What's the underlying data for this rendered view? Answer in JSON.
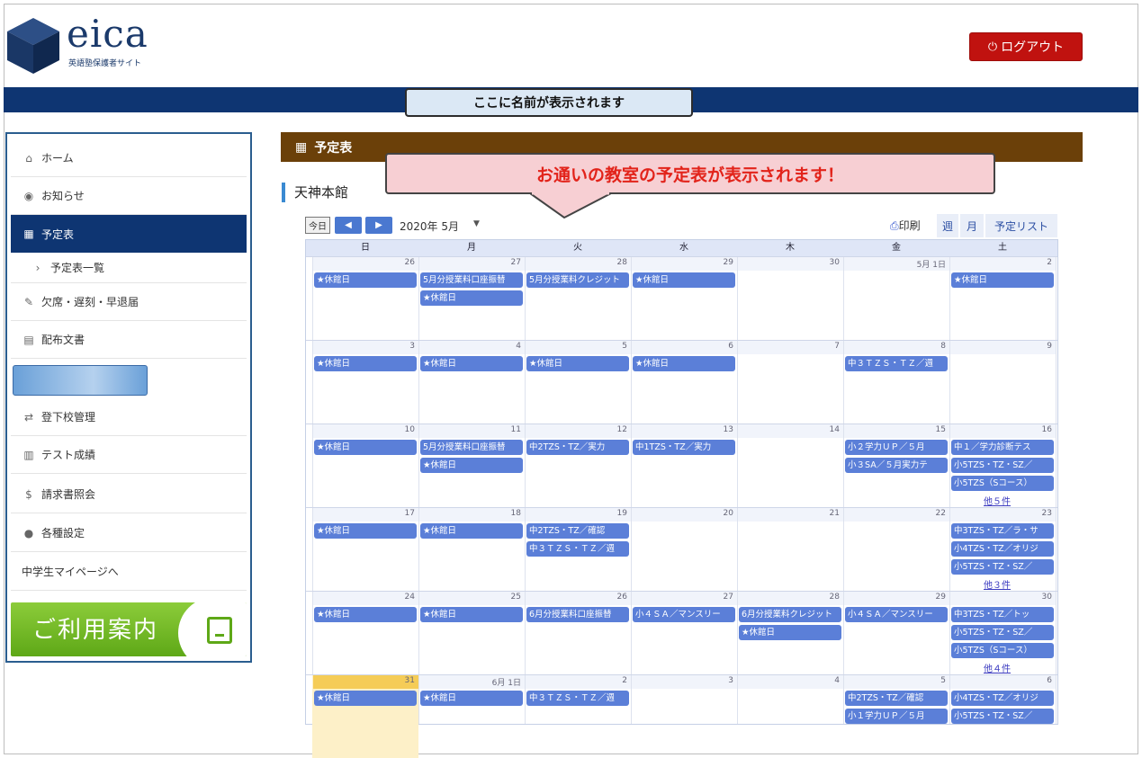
{
  "header": {
    "logo": "eica",
    "logo_sub": "英語塾保護者サイト",
    "logout_label": "ログアウト"
  },
  "name_banner": "ここに名前が表示されます",
  "sidebar": {
    "items": [
      {
        "icon": "home-icon",
        "glyph": "⌂",
        "label": "ホーム"
      },
      {
        "icon": "info-icon",
        "glyph": "◉",
        "label": "お知らせ"
      },
      {
        "icon": "calendar-icon",
        "glyph": "▦",
        "label": "予定表",
        "active": true
      },
      {
        "icon": "chevron-right-icon",
        "glyph": "›",
        "label": "予定表一覧",
        "sub": true
      },
      {
        "icon": "edit-icon",
        "glyph": "✎",
        "label": "欠席・遅刻・早退届"
      },
      {
        "icon": "document-icon",
        "glyph": "▤",
        "label": "配布文書"
      },
      {
        "icon": "transfer-icon",
        "glyph": "⇄",
        "label": "登下校管理"
      },
      {
        "icon": "bar-chart-icon",
        "glyph": "▥",
        "label": "テスト成績"
      },
      {
        "icon": "dollar-icon",
        "glyph": "$",
        "label": "請求書照会"
      },
      {
        "icon": "user-icon",
        "glyph": "●",
        "label": "各種設定"
      },
      {
        "icon": "none",
        "glyph": "",
        "label": "中学生マイページへ"
      }
    ],
    "guide_label": "ご利用案内"
  },
  "main": {
    "section_title": "予定表",
    "school_name": "天神本館",
    "callout": "お通いの教室の予定表が表示されます！"
  },
  "toolbar": {
    "today": "今日",
    "prev": "◀",
    "next": "▶",
    "month": "2020年 5月",
    "print": "印刷",
    "views": [
      "週",
      "月",
      "予定リスト"
    ]
  },
  "calendar": {
    "weekdays": [
      "日",
      "月",
      "火",
      "水",
      "木",
      "金",
      "土"
    ],
    "weeks": [
      {
        "days": [
          "26",
          "27",
          "28",
          "29",
          "30",
          "5月 1日",
          "2"
        ],
        "events": [
          [
            0,
            0,
            "★休館日"
          ],
          [
            1,
            0,
            "5月分授業料口座振替"
          ],
          [
            1,
            1,
            "★休館日"
          ],
          [
            2,
            0,
            "5月分授業料クレジット"
          ],
          [
            3,
            0,
            "★休館日"
          ],
          [
            6,
            0,
            "★休館日"
          ]
        ],
        "more": []
      },
      {
        "days": [
          "3",
          "4",
          "5",
          "6",
          "7",
          "8",
          "9"
        ],
        "events": [
          [
            0,
            0,
            "★休館日"
          ],
          [
            1,
            0,
            "★休館日"
          ],
          [
            2,
            0,
            "★休館日"
          ],
          [
            3,
            0,
            "★休館日"
          ],
          [
            5,
            0,
            "中３ＴＺＳ・ＴＺ／週"
          ]
        ],
        "more": []
      },
      {
        "days": [
          "10",
          "11",
          "12",
          "13",
          "14",
          "15",
          "16"
        ],
        "events": [
          [
            0,
            0,
            "★休館日"
          ],
          [
            1,
            0,
            "5月分授業料口座振替"
          ],
          [
            1,
            1,
            "★休館日"
          ],
          [
            2,
            0,
            "中2TZS・TZ／実力"
          ],
          [
            3,
            0,
            "中1TZS・TZ／実力"
          ],
          [
            5,
            0,
            "小２学力ＵＰ／５月"
          ],
          [
            5,
            1,
            "小３SA／５月実力テ"
          ],
          [
            6,
            0,
            "中１／学力診断テス"
          ],
          [
            6,
            1,
            "小5TZS・TZ・SZ／"
          ],
          [
            6,
            2,
            "小5TZS（Sコース）"
          ]
        ],
        "more": [
          [
            6,
            "他５件"
          ]
        ]
      },
      {
        "days": [
          "17",
          "18",
          "19",
          "20",
          "21",
          "22",
          "23"
        ],
        "events": [
          [
            0,
            0,
            "★休館日"
          ],
          [
            1,
            0,
            "★休館日"
          ],
          [
            2,
            0,
            "中2TZS・TZ／確認"
          ],
          [
            2,
            1,
            "中３ＴＺＳ・ＴＺ／週"
          ],
          [
            6,
            0,
            "中3TZS・TZ／ラ・サ"
          ],
          [
            6,
            1,
            "小4TZS・TZ／オリジ"
          ],
          [
            6,
            2,
            "小5TZS・TZ・SZ／"
          ]
        ],
        "more": [
          [
            6,
            "他３件"
          ]
        ]
      },
      {
        "days": [
          "24",
          "25",
          "26",
          "27",
          "28",
          "29",
          "30"
        ],
        "events": [
          [
            0,
            0,
            "★休館日"
          ],
          [
            1,
            0,
            "★休館日"
          ],
          [
            2,
            0,
            "6月分授業料口座振替"
          ],
          [
            3,
            0,
            "小４ＳＡ／マンスリー"
          ],
          [
            4,
            0,
            "6月分授業料クレジット"
          ],
          [
            4,
            1,
            "★休館日"
          ],
          [
            5,
            0,
            "小４ＳＡ／マンスリー"
          ],
          [
            6,
            0,
            "中3TZS・TZ／トッ"
          ],
          [
            6,
            1,
            "小5TZS・TZ・SZ／"
          ],
          [
            6,
            2,
            "小5TZS（Sコース）"
          ]
        ],
        "more": [
          [
            6,
            "他４件"
          ]
        ]
      },
      {
        "days": [
          "31",
          "6月 1日",
          "2",
          "3",
          "4",
          "5",
          "6"
        ],
        "events": [
          [
            0,
            0,
            "★休館日"
          ],
          [
            1,
            0,
            "★休館日"
          ],
          [
            2,
            0,
            "中３ＴＺＳ・ＴＺ／週"
          ],
          [
            5,
            0,
            "中2TZS・TZ／確認"
          ],
          [
            5,
            1,
            "小１学力ＵＰ／５月"
          ],
          [
            6,
            0,
            "小4TZS・TZ／オリジ"
          ],
          [
            6,
            1,
            "小5TZS・TZ・SZ／"
          ]
        ],
        "more": []
      }
    ],
    "today_cell": [
      5,
      0
    ]
  }
}
